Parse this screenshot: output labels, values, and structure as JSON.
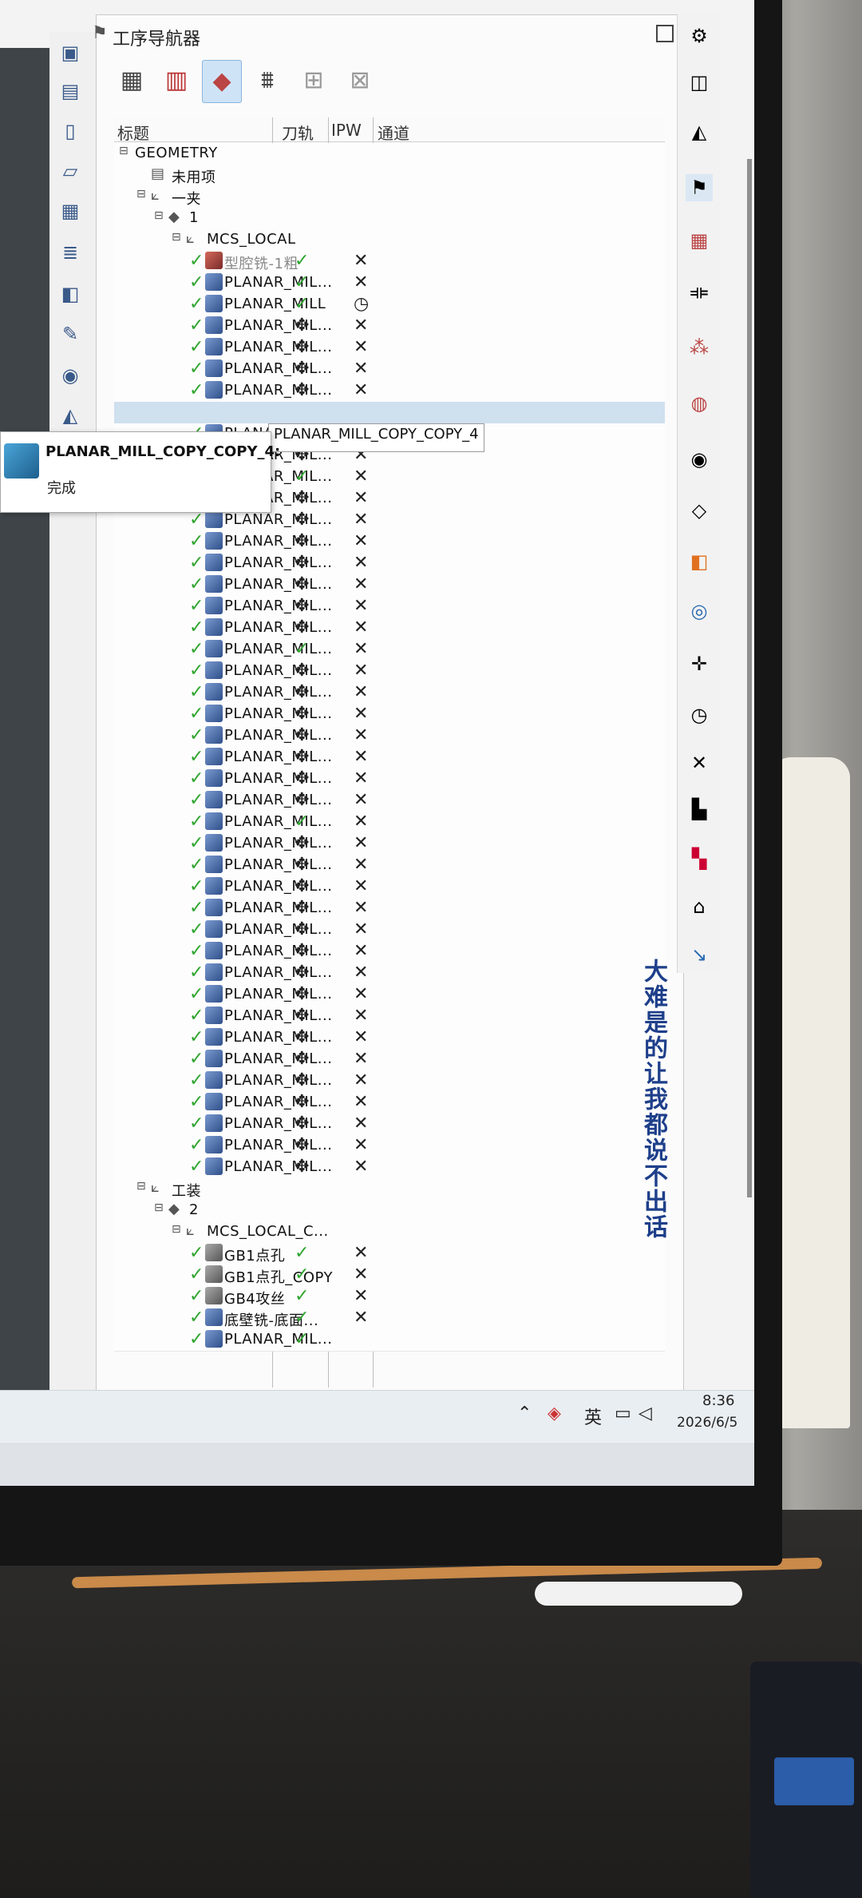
{
  "navigator": {
    "title": "工序导航器",
    "columns": {
      "name": "标题",
      "toolpath": "刀轨",
      "ipw": "IPW",
      "channel": "通道"
    }
  },
  "tooltip": {
    "title": "PLANAR_MILL_COPY_COPY_4:",
    "status": "完成"
  },
  "hover_label": "PLANAR_MILL_COPY_COPY_4",
  "watermark": "大难是的让我都说不出话",
  "taskbar": {
    "ime": "英",
    "time": "8:36",
    "date": "2026/6/5"
  },
  "tree": [
    {
      "name": "GEOMETRY",
      "indent": 0,
      "type": "root"
    },
    {
      "name": "未用项",
      "indent": 1,
      "type": "folder"
    },
    {
      "name": "一夹",
      "indent": 1,
      "type": "mcs"
    },
    {
      "name": "1",
      "indent": 2,
      "type": "workpiece"
    },
    {
      "name": "MCS_LOCAL",
      "indent": 3,
      "type": "mcs"
    },
    {
      "name": "型腔铣-1粗",
      "indent": 4,
      "type": "op",
      "style": "gray",
      "path": "check",
      "ipw": "x"
    },
    {
      "name": "PLANAR_MIL...",
      "indent": 4,
      "type": "op",
      "path": "check",
      "ipw": "x"
    },
    {
      "name": "PLANAR_MILL",
      "indent": 4,
      "type": "op",
      "path": "check",
      "ipw": "clock"
    },
    {
      "name": "PLANAR_MIL...",
      "indent": 4,
      "type": "op",
      "path": "move",
      "ipw": "x"
    },
    {
      "name": "PLANAR_MIL...",
      "indent": 4,
      "type": "op",
      "path": "move",
      "ipw": "x"
    },
    {
      "name": "PLANAR_MIL...",
      "indent": 4,
      "type": "op",
      "path": "move",
      "ipw": "x"
    },
    {
      "name": "PLANAR_MIL...",
      "indent": 4,
      "type": "op",
      "path": "move",
      "ipw": "x"
    },
    {
      "name": "",
      "indent": 4,
      "type": "op",
      "path": "",
      "ipw": "",
      "selected": true
    },
    {
      "name": "PLANAR_MIL...",
      "indent": 4,
      "type": "op",
      "path": "move",
      "ipw": "x"
    },
    {
      "name": "PLANAR_MIL...",
      "indent": 4,
      "type": "op",
      "path": "move",
      "ipw": "x"
    },
    {
      "name": "PLANAR_MIL...",
      "indent": 4,
      "type": "op",
      "path": "check",
      "ipw": "x"
    },
    {
      "name": "PLANAR_MIL...",
      "indent": 4,
      "type": "op",
      "path": "move",
      "ipw": "x"
    },
    {
      "name": "PLANAR_MIL...",
      "indent": 4,
      "type": "op",
      "path": "move",
      "ipw": "x"
    },
    {
      "name": "PLANAR_MIL...",
      "indent": 4,
      "type": "op",
      "path": "move",
      "ipw": "x"
    },
    {
      "name": "PLANAR_MIL...",
      "indent": 4,
      "type": "op",
      "path": "move",
      "ipw": "x"
    },
    {
      "name": "PLANAR_MIL...",
      "indent": 4,
      "type": "op",
      "path": "move",
      "ipw": "x"
    },
    {
      "name": "PLANAR_MIL...",
      "indent": 4,
      "type": "op",
      "path": "move",
      "ipw": "x"
    },
    {
      "name": "PLANAR_MIL...",
      "indent": 4,
      "type": "op",
      "path": "move",
      "ipw": "x"
    },
    {
      "name": "PLANAR_MIL...",
      "indent": 4,
      "type": "op",
      "path": "check",
      "ipw": "x"
    },
    {
      "name": "PLANAR_MIL...",
      "indent": 4,
      "type": "op",
      "path": "move",
      "ipw": "x"
    },
    {
      "name": "PLANAR_MIL...",
      "indent": 4,
      "type": "op",
      "path": "move",
      "ipw": "x"
    },
    {
      "name": "PLANAR_MIL...",
      "indent": 4,
      "type": "op",
      "path": "move",
      "ipw": "x"
    },
    {
      "name": "PLANAR_MIL...",
      "indent": 4,
      "type": "op",
      "path": "move",
      "ipw": "x"
    },
    {
      "name": "PLANAR_MIL...",
      "indent": 4,
      "type": "op",
      "path": "move",
      "ipw": "x"
    },
    {
      "name": "PLANAR_MIL...",
      "indent": 4,
      "type": "op",
      "path": "move",
      "ipw": "x"
    },
    {
      "name": "PLANAR_MIL...",
      "indent": 4,
      "type": "op",
      "path": "move",
      "ipw": "x"
    },
    {
      "name": "PLANAR_MIL...",
      "indent": 4,
      "type": "op",
      "path": "check",
      "ipw": "x"
    },
    {
      "name": "PLANAR_MIL...",
      "indent": 4,
      "type": "op",
      "path": "move",
      "ipw": "x"
    },
    {
      "name": "PLANAR_MIL...",
      "indent": 4,
      "type": "op",
      "path": "move",
      "ipw": "x"
    },
    {
      "name": "PLANAR_MIL...",
      "indent": 4,
      "type": "op",
      "path": "move",
      "ipw": "x"
    },
    {
      "name": "PLANAR_MIL...",
      "indent": 4,
      "type": "op",
      "path": "move",
      "ipw": "x"
    },
    {
      "name": "PLANAR_MIL...",
      "indent": 4,
      "type": "op",
      "path": "move",
      "ipw": "x"
    },
    {
      "name": "PLANAR_MIL...",
      "indent": 4,
      "type": "op",
      "path": "move",
      "ipw": "x"
    },
    {
      "name": "PLANAR_MIL...",
      "indent": 4,
      "type": "op",
      "path": "move",
      "ipw": "x"
    },
    {
      "name": "PLANAR_MIL...",
      "indent": 4,
      "type": "op",
      "path": "move",
      "ipw": "x"
    },
    {
      "name": "PLANAR_MIL...",
      "indent": 4,
      "type": "op",
      "path": "move",
      "ipw": "x"
    },
    {
      "name": "PLANAR_MIL...",
      "indent": 4,
      "type": "op",
      "path": "move",
      "ipw": "x"
    },
    {
      "name": "PLANAR_MIL...",
      "indent": 4,
      "type": "op",
      "path": "move",
      "ipw": "x"
    },
    {
      "name": "PLANAR_MIL...",
      "indent": 4,
      "type": "op",
      "path": "move",
      "ipw": "x"
    },
    {
      "name": "PLANAR_MIL...",
      "indent": 4,
      "type": "op",
      "path": "move",
      "ipw": "x"
    },
    {
      "name": "PLANAR_MIL...",
      "indent": 4,
      "type": "op",
      "path": "move",
      "ipw": "x"
    },
    {
      "name": "PLANAR_MIL...",
      "indent": 4,
      "type": "op",
      "path": "move",
      "ipw": "x"
    },
    {
      "name": "PLANAR_MIL...",
      "indent": 4,
      "type": "op",
      "path": "move",
      "ipw": "x"
    },
    {
      "name": "工装",
      "indent": 1,
      "type": "mcs"
    },
    {
      "name": "2",
      "indent": 2,
      "type": "workpiece"
    },
    {
      "name": "MCS_LOCAL_C...",
      "indent": 3,
      "type": "mcs"
    },
    {
      "name": "GB1点孔",
      "indent": 4,
      "type": "drill",
      "path": "check",
      "ipw": "x"
    },
    {
      "name": "GB1点孔_COPY",
      "indent": 4,
      "type": "drill",
      "path": "check",
      "ipw": "x"
    },
    {
      "name": "GB4攻丝",
      "indent": 4,
      "type": "drill",
      "path": "check",
      "ipw": "x"
    },
    {
      "name": "底壁铣-底面...",
      "indent": 4,
      "type": "op",
      "path": "check",
      "ipw": "x"
    },
    {
      "name": "PLANAR_MIL...",
      "indent": 4,
      "type": "op",
      "path": "check",
      "ipw": ""
    }
  ]
}
